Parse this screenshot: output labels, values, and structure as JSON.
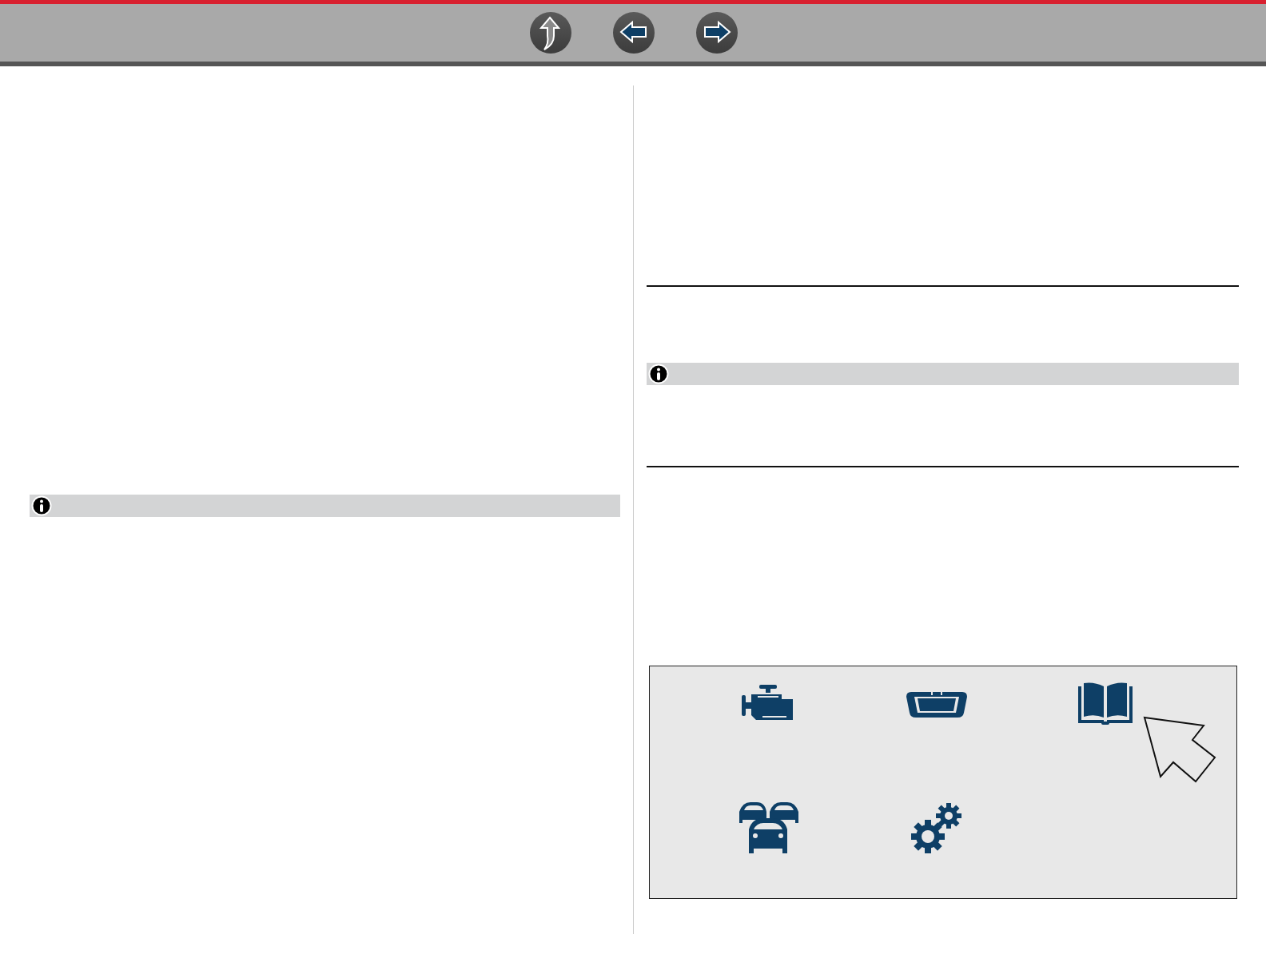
{
  "toolbar": {
    "buttons": [
      {
        "kind": "up"
      },
      {
        "kind": "back"
      },
      {
        "kind": "forward"
      }
    ]
  },
  "left_column": {
    "blocks": [
      {
        "kind": "note"
      }
    ]
  },
  "right_column": {
    "blocks": [
      {
        "kind": "rule"
      },
      {
        "kind": "note"
      },
      {
        "kind": "rule"
      },
      {
        "kind": "icon_panel",
        "pointer": true,
        "items": [
          {
            "kind": "engine"
          },
          {
            "kind": "windshield"
          },
          {
            "kind": "book"
          },
          {
            "kind": "cars"
          },
          {
            "kind": "gears"
          }
        ]
      }
    ]
  }
}
